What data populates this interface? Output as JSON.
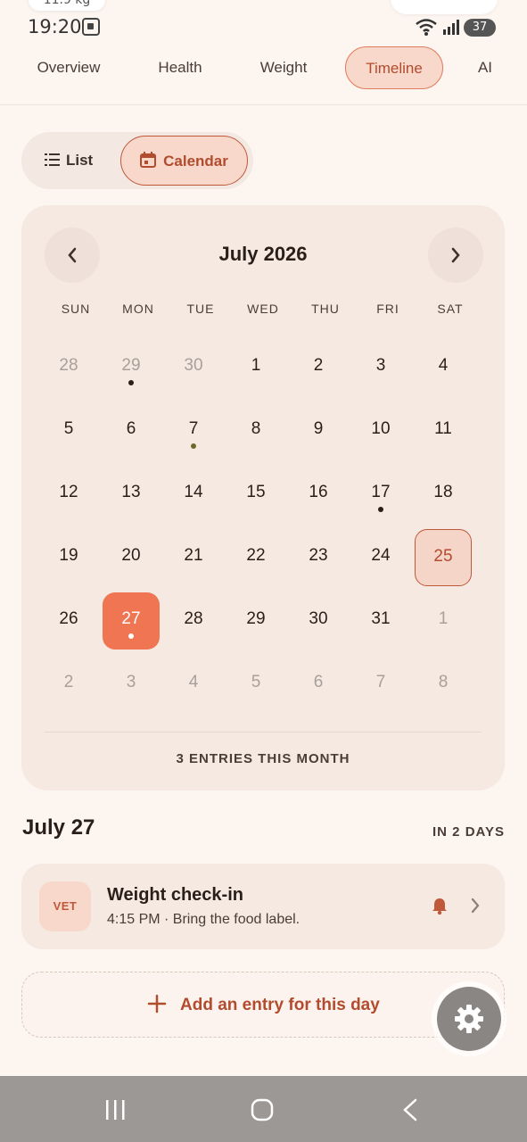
{
  "status": {
    "time": "19:20",
    "top_cut_text": "11.9 kg",
    "battery": "37"
  },
  "tabs": [
    {
      "label": "Overview"
    },
    {
      "label": "Health"
    },
    {
      "label": "Weight"
    },
    {
      "label": "Timeline"
    },
    {
      "label": "AI"
    }
  ],
  "active_tab": "Timeline",
  "view_toggle": {
    "list": "List",
    "calendar": "Calendar",
    "selected": "Calendar"
  },
  "calendar": {
    "month_label": "July 2026",
    "weekdays": [
      "SUN",
      "MON",
      "TUE",
      "WED",
      "THU",
      "FRI",
      "SAT"
    ],
    "weeks": [
      [
        "28",
        "29",
        "30",
        "1",
        "2",
        "3",
        "4"
      ],
      [
        "5",
        "6",
        "7",
        "8",
        "9",
        "10",
        "11"
      ],
      [
        "12",
        "13",
        "14",
        "15",
        "16",
        "17",
        "18"
      ],
      [
        "19",
        "20",
        "21",
        "22",
        "23",
        "24",
        "25"
      ],
      [
        "26",
        "27",
        "28",
        "29",
        "30",
        "31",
        "1"
      ],
      [
        "2",
        "3",
        "4",
        "5",
        "6",
        "7",
        "8"
      ]
    ],
    "selected_day": "27",
    "today": "25",
    "entries_count": "3 ENTRIES THIS MONTH"
  },
  "day_detail": {
    "title": "July 27",
    "relative": "IN 2 DAYS",
    "entry": {
      "badge": "VET",
      "title": "Weight check-in",
      "subtitle": "4:15 PM · Bring the food label."
    },
    "add_label": "Add an entry for this day"
  },
  "colors": {
    "accent": "#ef7553",
    "accent_dark": "#b24c2e",
    "background": "#fdf5f0",
    "card": "#f5e9e2"
  }
}
